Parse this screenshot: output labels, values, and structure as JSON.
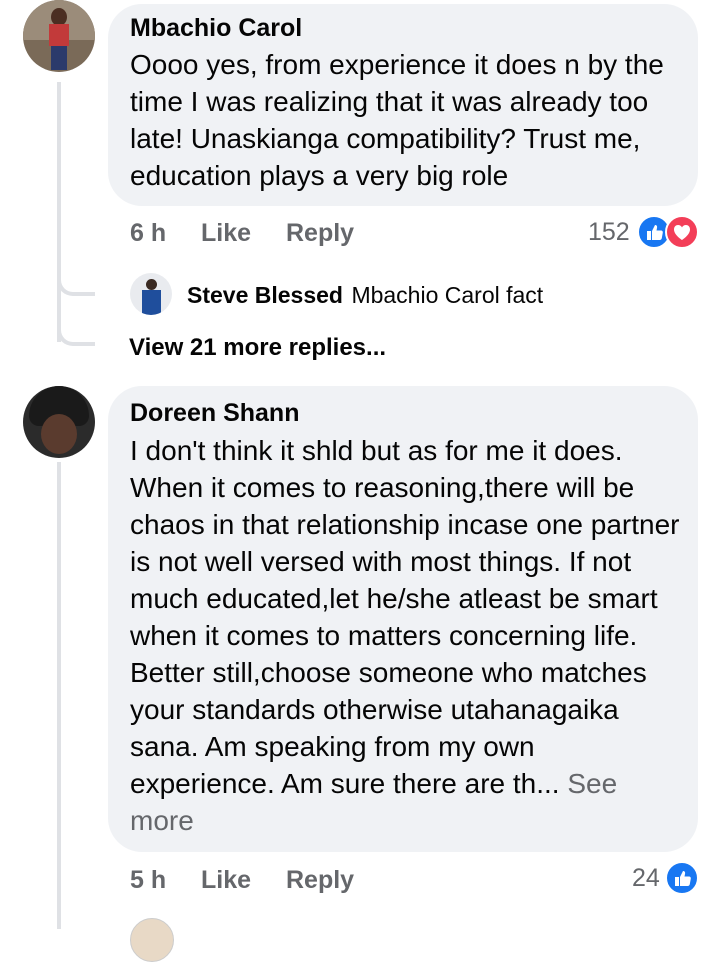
{
  "comments": [
    {
      "author": "Mbachio Carol",
      "text": "Oooo yes, from experience it does n by the time I was realizing that it was already too late! Unaskianga compatibility? Trust me, education plays a very big role",
      "time": "6 h",
      "like_label": "Like",
      "reply_label": "Reply",
      "reaction_count": "152",
      "reactions": [
        "like-icon",
        "love-icon"
      ],
      "replies": [
        {
          "author": "Steve Blessed",
          "text": "Mbachio Carol fact"
        }
      ],
      "view_more_label": "View 21 more replies..."
    },
    {
      "author": "Doreen Shann",
      "text": "I don't think it shld but as for me it does. When it comes to reasoning,there will be chaos in that relationship incase one partner is not well versed with most things. If not much educated,let he/she atleast be smart when it comes to matters concerning life. Better still,choose someone who matches your standards otherwise utahanagaika sana. Am speaking from my own experience. Am sure there are th...",
      "see_more_label": "See more",
      "time": "5 h",
      "like_label": "Like",
      "reply_label": "Reply",
      "reaction_count": "24",
      "reactions": [
        "like-icon"
      ]
    }
  ],
  "colors": {
    "like": "#1877f2",
    "love": "#f33e58",
    "bubble": "#f0f2f5",
    "meta": "#65676b"
  }
}
